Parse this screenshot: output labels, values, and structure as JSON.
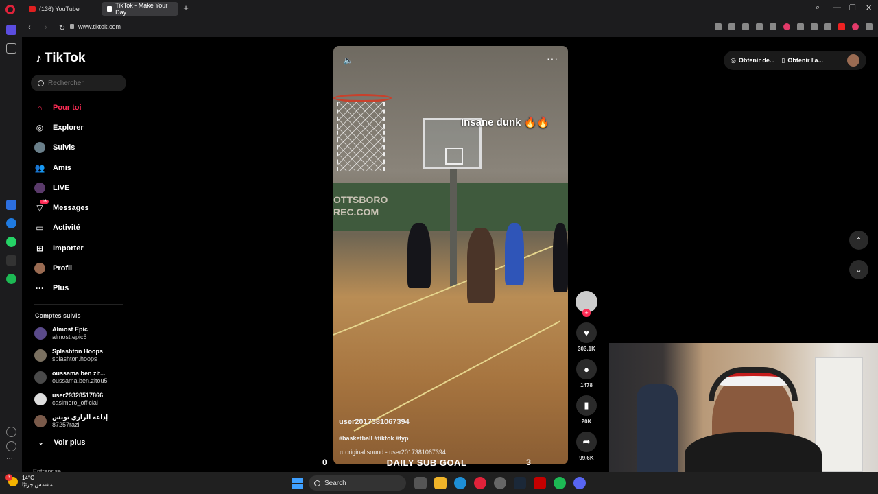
{
  "browser": {
    "tabs": [
      {
        "label": "(136) YouTube"
      },
      {
        "label": "TikTok - Make Your Day"
      }
    ],
    "url": "www.tiktok.com"
  },
  "tiktok": {
    "logo_text": "TikTok",
    "search_placeholder": "Rechercher",
    "nav": [
      {
        "label": "Pour toi",
        "icon": "home-icon"
      },
      {
        "label": "Explorer",
        "icon": "compass-icon"
      },
      {
        "label": "Suivis",
        "icon": "following-avatar-icon"
      },
      {
        "label": "Amis",
        "icon": "friends-icon"
      },
      {
        "label": "LIVE",
        "icon": "live-avatar-icon"
      },
      {
        "label": "Messages",
        "icon": "messages-icon",
        "badge": "16"
      },
      {
        "label": "Activité",
        "icon": "activity-icon"
      },
      {
        "label": "Importer",
        "icon": "upload-icon"
      },
      {
        "label": "Profil",
        "icon": "profile-avatar-icon"
      },
      {
        "label": "Plus",
        "icon": "more-icon"
      }
    ],
    "followed_title": "Comptes suivis",
    "followed": [
      {
        "name": "Almost Epic",
        "handle": "almost.epic5"
      },
      {
        "name": "Splashton Hoops",
        "handle": "splashton.hoops"
      },
      {
        "name": "oussama ben zit...",
        "handle": "oussama.ben.zitou5"
      },
      {
        "name": "user29328517866",
        "handle": "casimero_official"
      },
      {
        "name": "إذاعة الرازي تونس",
        "handle": "87257razi"
      }
    ],
    "see_more": "Voir plus",
    "footer_partial": "Entreprise",
    "top_right": {
      "btn1": "Obtenir de...",
      "btn2": "Obtenir l'a..."
    }
  },
  "video": {
    "caption_overlay": "Insane dunk 🔥🔥",
    "wall_text": "OTTSBORO\nREC.COM",
    "username": "user2017381067394",
    "tags": "#basketball #tiktok #fyp",
    "sound": "original sound - user2017381067394",
    "likes": "303.1K",
    "comments": "1478",
    "saves": "20K",
    "shares": "99.6K"
  },
  "goal": {
    "left": "0",
    "title": "DAILY SUB GOAL",
    "right": "3"
  },
  "taskbar": {
    "temp": "14°C",
    "weather_desc": "مشمس جزئيًا",
    "weather_badge": "3",
    "search": "Search"
  },
  "colors": {
    "accent": "#fe2c55",
    "background": "#000000"
  }
}
